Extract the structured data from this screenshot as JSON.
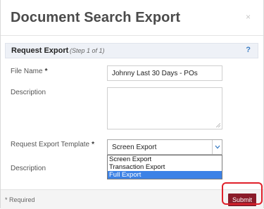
{
  "dialog": {
    "title": "Document Search Export",
    "close_glyph": "×"
  },
  "section": {
    "title": "Request Export",
    "step": "(Step 1 of 1)",
    "help": "?"
  },
  "form": {
    "file_name_label": "File Name",
    "file_name_value": "Johnny Last 30 Days - POs",
    "description_label": "Description",
    "description_value": "",
    "template_label": "Request Export Template",
    "template_selected": "Screen Export",
    "template_options": [
      "Screen Export",
      "Transaction Export",
      "Full Export"
    ],
    "template_highlighted": "Full Export",
    "description2_label": "Description",
    "required_marker": "*"
  },
  "footer": {
    "required_note": "* Required",
    "submit_label": "Submit"
  },
  "colors": {
    "submit_bg": "#8a1c2a",
    "highlight_option": "#3c82e6",
    "annotation_box": "#e0202a"
  }
}
